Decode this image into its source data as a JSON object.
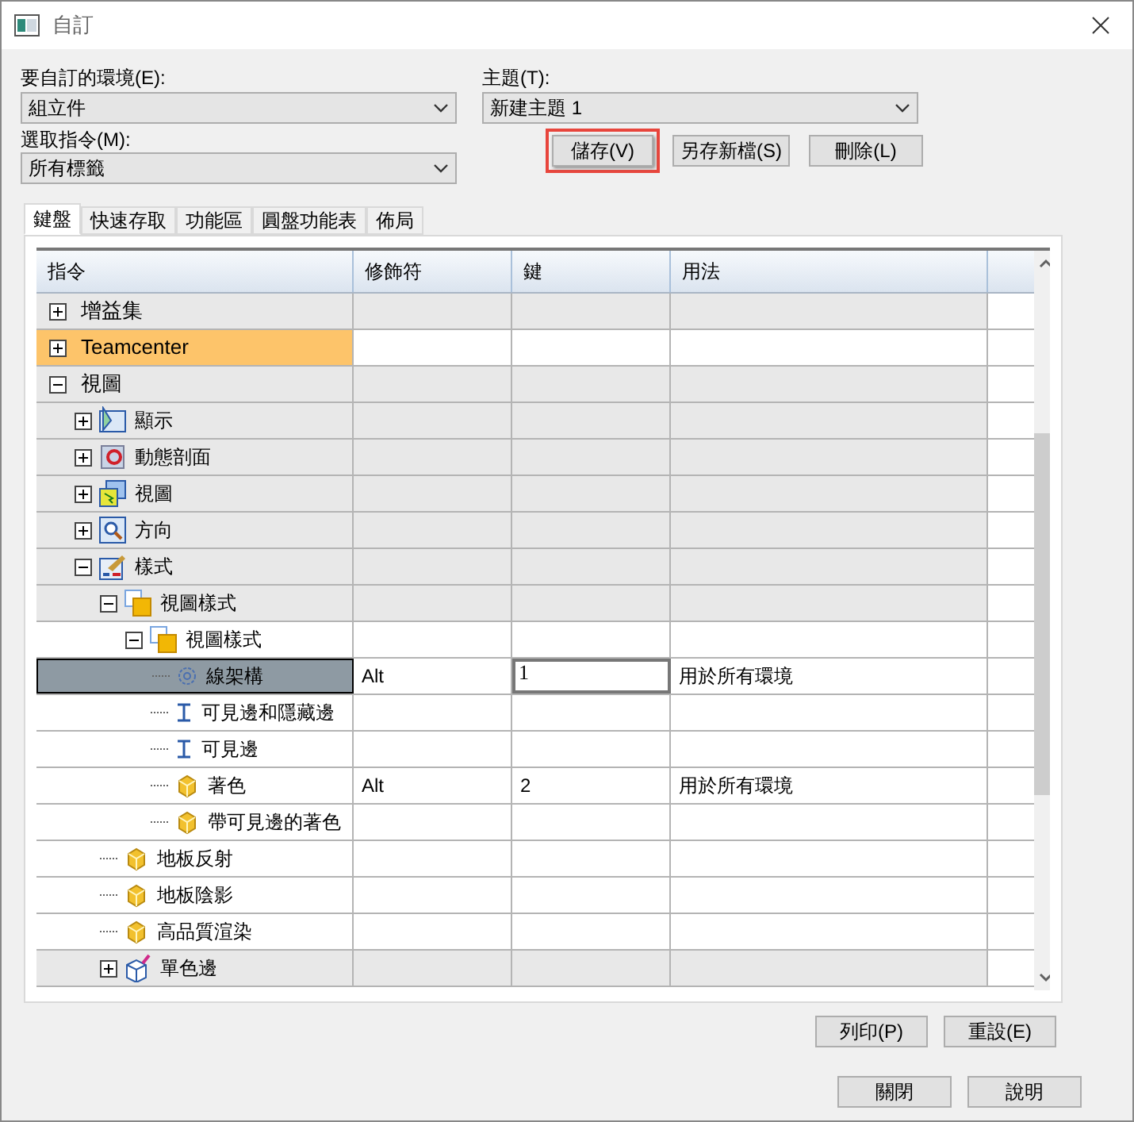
{
  "window": {
    "title": "自訂"
  },
  "environment": {
    "label": "要自訂的環境(E):",
    "value": "組立件"
  },
  "command_filter": {
    "label": "選取指令(M):",
    "value": "所有標籤"
  },
  "theme": {
    "label": "主題(T):",
    "value": "新建主題 1"
  },
  "theme_buttons": [
    {
      "label": "儲存(V)",
      "highlighted": true
    },
    {
      "label": "另存新檔(S)",
      "highlighted": false
    },
    {
      "label": "刪除(L)",
      "highlighted": false
    }
  ],
  "tabs": [
    {
      "label": "鍵盤",
      "selected": true
    },
    {
      "label": "快速存取",
      "selected": false
    },
    {
      "label": "功能區",
      "selected": false
    },
    {
      "label": "圓盤功能表",
      "selected": false
    },
    {
      "label": "佈局",
      "selected": false
    }
  ],
  "table": {
    "columns": [
      "指令",
      "修飾符",
      "鍵",
      "用法"
    ],
    "rows": [
      {
        "label": "增益集",
        "kind": "group",
        "expanded": false,
        "selected": false
      },
      {
        "label": "Teamcenter",
        "kind": "group",
        "expanded": false,
        "selected": false,
        "color": "#fdc46a"
      },
      {
        "label": "視圖",
        "kind": "group",
        "expanded": true,
        "selected": false,
        "children": [
          {
            "label": "顯示",
            "kind": "group",
            "expanded": false,
            "selected": false
          },
          {
            "label": "動態剖面",
            "kind": "group",
            "expanded": false,
            "selected": false
          },
          {
            "label": "視圖",
            "kind": "group",
            "expanded": false,
            "selected": false
          },
          {
            "label": "方向",
            "kind": "group",
            "expanded": false,
            "selected": false
          },
          {
            "label": "樣式",
            "kind": "group",
            "expanded": true,
            "selected": false,
            "children": [
              {
                "label": "視圖樣式",
                "kind": "group",
                "expanded": true,
                "selected": false,
                "children": [
                  {
                    "label": "視圖樣式",
                    "kind": "command",
                    "expanded": true,
                    "selected": false,
                    "children": [
                      {
                        "label": "線架構",
                        "kind": "command",
                        "selected": true,
                        "modifier": "Alt",
                        "key": "1",
                        "usage": "用於所有環境"
                      },
                      {
                        "label": "可見邊和隱藏邊",
                        "kind": "command",
                        "selected": false
                      },
                      {
                        "label": "可見邊",
                        "kind": "command",
                        "selected": false
                      },
                      {
                        "label": "著色",
                        "kind": "command",
                        "selected": false,
                        "modifier": "Alt",
                        "key": "2",
                        "usage": "用於所有環境"
                      },
                      {
                        "label": "帶可見邊的著色",
                        "kind": "command",
                        "selected": false
                      }
                    ]
                  }
                ]
              },
              {
                "label": "地板反射",
                "kind": "command",
                "selected": false
              },
              {
                "label": "地板陰影",
                "kind": "command",
                "selected": false
              },
              {
                "label": "高品質渲染",
                "kind": "command",
                "selected": false
              },
              {
                "label": "單色邊",
                "kind": "group",
                "expanded": false,
                "selected": false
              }
            ]
          }
        ]
      }
    ]
  },
  "table_buttons": [
    "列印(P)",
    "重設(E)"
  ],
  "footer_buttons": [
    "關閉",
    "說明"
  ]
}
